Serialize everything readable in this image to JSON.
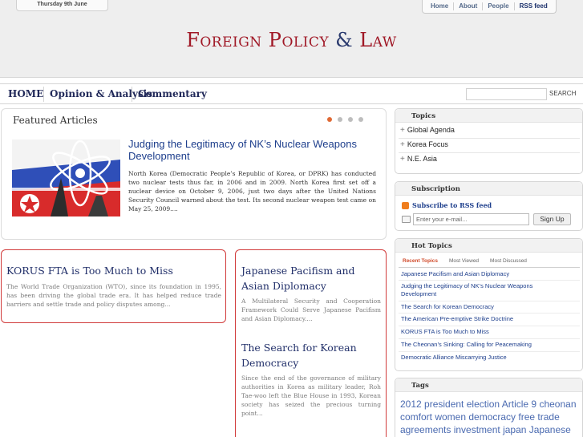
{
  "header": {
    "date": "Thursday 9th June",
    "links": [
      "Home",
      "About",
      "People",
      "RSS feed"
    ],
    "logo": {
      "part1": "Foreign Policy",
      "amp": "&",
      "part2": "Law"
    }
  },
  "nav": {
    "items": [
      "HOME",
      "Opinion & Analysis",
      "Commentary"
    ],
    "search_label": "SEARCH"
  },
  "featured": {
    "title": "Featured Articles",
    "headline": "Judging the Legitimacy of NK’s Nuclear Weapons Development",
    "text": "North Korea (Democratic People’s Republic of Korea, or DPRK) has conducted two nuclear tests thus far, in 2006 and in 2009. North Korea first set off a nuclear device on October 9, 2006, just two days after the United Nations Security Council warned about the test. Its second nuclear weapon test came on May 25, 2009...."
  },
  "articles": [
    {
      "title": "KORUS FTA is Too Much to Miss",
      "text": "The World Trade Organization (WTO), since its foundation in 1995, has been driving the global trade era. It has helped reduce trade barriers and settle trade and policy disputes among..."
    },
    {
      "title": "Japanese Pacifism and Asian Diplomacy",
      "text": "A Multilateral Security and Cooperation Framework Could Serve Japanese Pacifism and Asian Diplomacy...."
    },
    {
      "title": "The Search for Korean Democracy",
      "text": "Since the end of the governance of military authorities in Korea as military leader, Roh Tae-woo left the Blue House in 1993, Korean society has seized the precious turning point..."
    }
  ],
  "sidebar": {
    "topics": {
      "title": "Topics",
      "items": [
        "Global Agenda",
        "Korea Focus",
        "N.E. Asia"
      ]
    },
    "subscription": {
      "title": "Subscription",
      "rss_label": "Subscribe to RSS feed",
      "email_placeholder": "Enter your e-mail...",
      "signup_label": "Sign Up"
    },
    "hot_topics": {
      "title": "Hot Topics",
      "tabs": [
        "Recent Topics",
        "Most Viewed",
        "Most Discussed"
      ],
      "items": [
        "Japanese Pacifism and Asian Diplomacy",
        "Judging the Legitimacy of NK’s Nuclear Weapons Development",
        "The Search for Korean Democracy",
        "The American Pre-emptive Strike Doctrine",
        "KORUS FTA is Too Much to Miss",
        "The Cheonan’s Sinking: Calling for Peacemaking",
        "Democratic Alliance Miscarrying Justice"
      ]
    },
    "tags": {
      "title": "Tags",
      "text": "2012 president election Article 9 cheonan comfort women democracy free trade agreements investment japan Japanese"
    }
  },
  "colors": {
    "logo_red": "#a01826",
    "link_blue": "#1d3e8c",
    "card_border_red": "#d13b3b",
    "active_dot": "#e06a35"
  }
}
